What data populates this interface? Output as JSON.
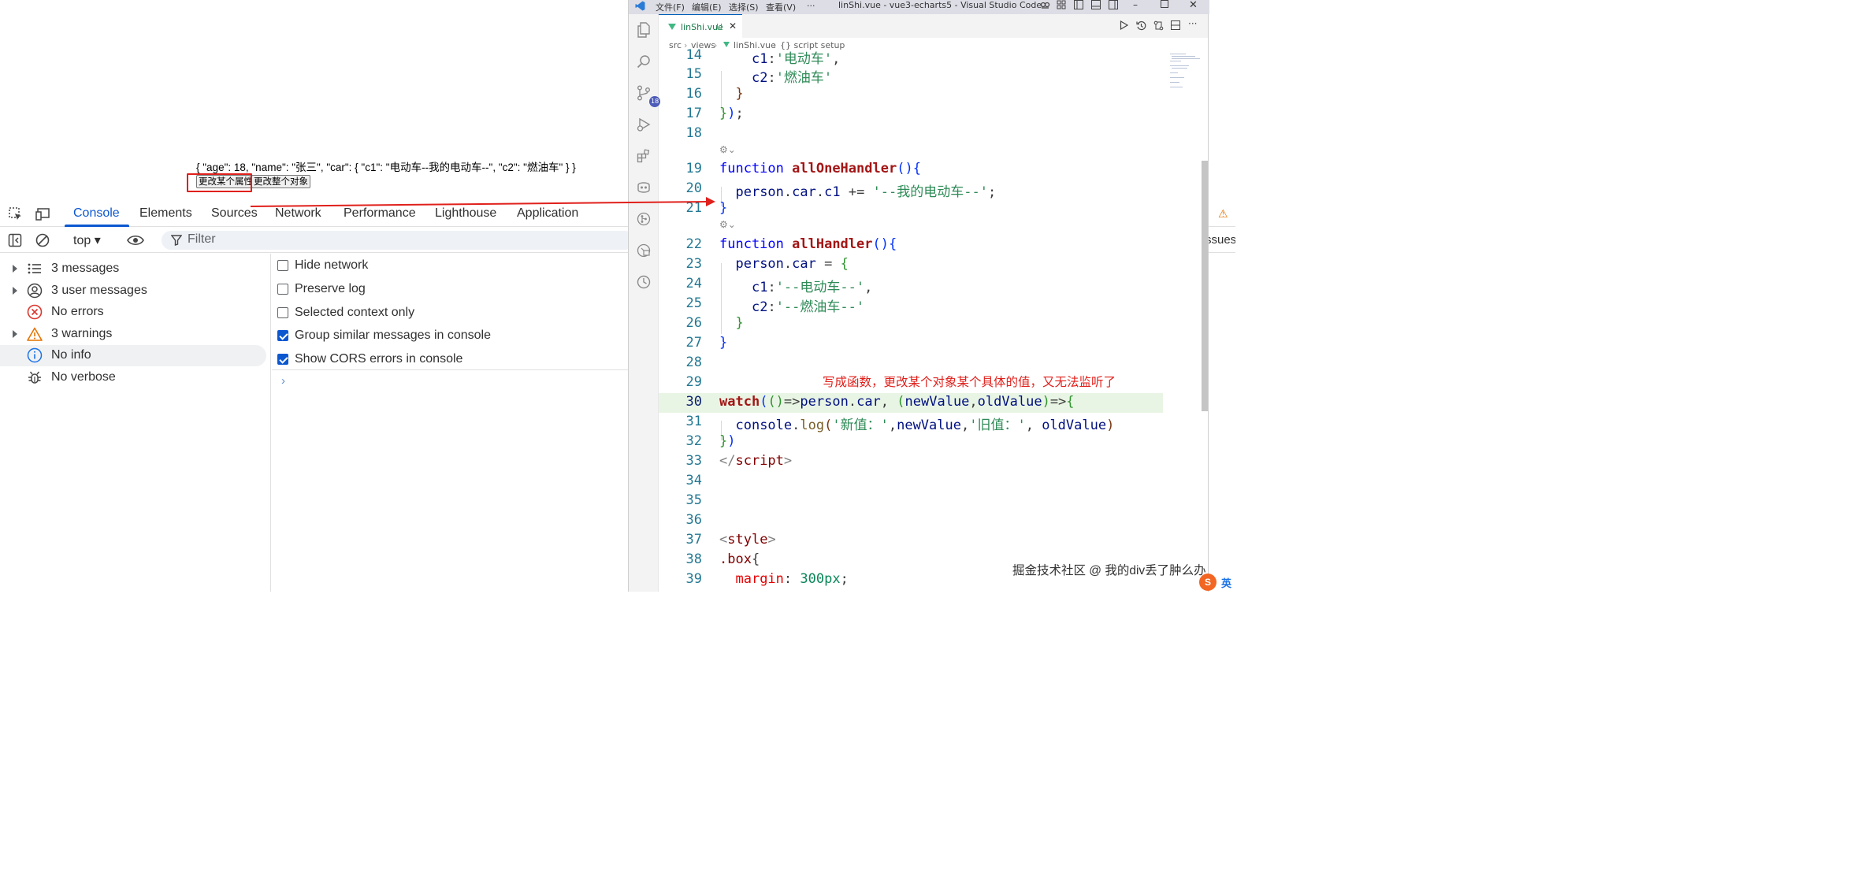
{
  "page": {
    "json_text": "{ \"age\": 18, \"name\": \"张三\", \"car\": { \"c1\": \"电动车--我的电动车--\", \"c2\": \"燃油车\" } }",
    "button_change_prop": "更改某个属性",
    "button_change_obj": "更改整个对象"
  },
  "devtools": {
    "tabs": [
      "Console",
      "Elements",
      "Sources",
      "Network",
      "Performance",
      "Lighthouse",
      "Application"
    ],
    "context": "top ▾",
    "filter_placeholder": "Filter",
    "issues_label": "ssues",
    "sidebar": [
      {
        "label": "3 messages",
        "icon": "list-icon",
        "expandable": true
      },
      {
        "label": "3 user messages",
        "icon": "user-icon",
        "expandable": true
      },
      {
        "label": "No errors",
        "icon": "error-icon",
        "expandable": false
      },
      {
        "label": "3 warnings",
        "icon": "warning-icon",
        "expandable": true
      },
      {
        "label": "No info",
        "icon": "info-icon",
        "expandable": false,
        "selected": true
      },
      {
        "label": "No verbose",
        "icon": "bug-icon",
        "expandable": false
      }
    ],
    "settings": [
      {
        "label": "Hide network",
        "checked": false
      },
      {
        "label": "Preserve log",
        "checked": false
      },
      {
        "label": "Selected context only",
        "checked": false
      },
      {
        "label": "Group similar messages in console",
        "checked": true
      },
      {
        "label": "Show CORS errors in console",
        "checked": true
      }
    ]
  },
  "vscode": {
    "menu": [
      "文件(F)",
      "编辑(E)",
      "选择(S)",
      "查看(V)",
      "···"
    ],
    "window_title": "linShi.vue - vue3-echarts5 - Visual Studio Code",
    "scm_badge": "18",
    "tab_name": "linShi.vue",
    "tab_status": "U",
    "breadcrumb": [
      "src",
      "views",
      "linShi.vue",
      "{} script setup"
    ],
    "annotation": "写成函数，更改某个对象某个具体的值，又无法监听了",
    "line_numbers": [
      "14",
      "15",
      "16",
      "17",
      "18",
      "19",
      "20",
      "21",
      "22",
      "23",
      "24",
      "25",
      "26",
      "27",
      "28",
      "29",
      "30",
      "31",
      "32",
      "33",
      "34",
      "35",
      "36",
      "37",
      "38",
      "39"
    ]
  },
  "watermark": "掘金技术社区 @ 我的div丢了肿么办",
  "ime": {
    "icon_text": "S",
    "label": "英"
  },
  "colors": {
    "accent": "#0b57d0",
    "annotation_red": "#e0201b",
    "vscode_title_bg": "#dddde6"
  }
}
